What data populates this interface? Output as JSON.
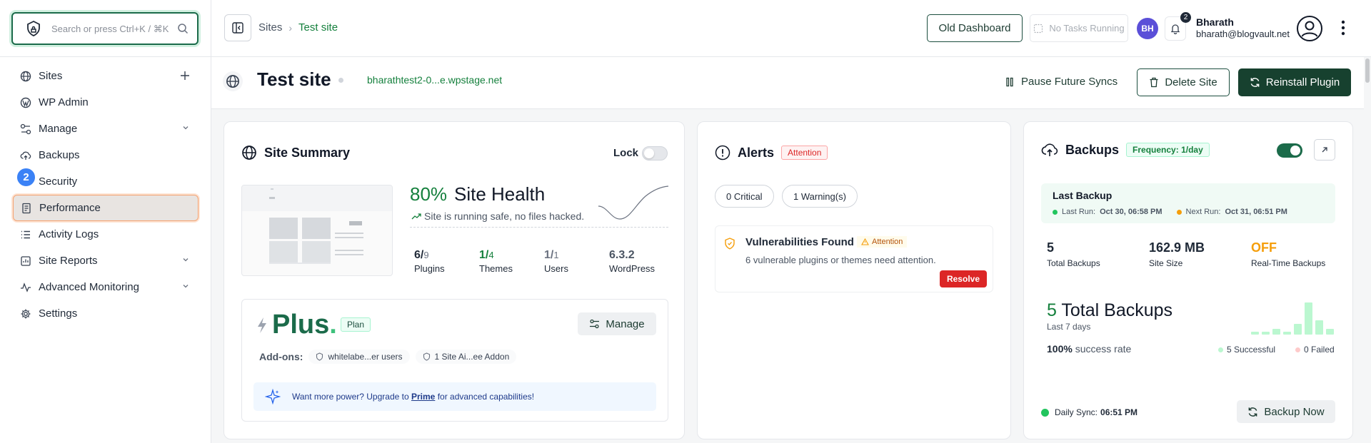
{
  "search": {
    "placeholder": "Search or press Ctrl+K / ⌘K"
  },
  "sidebar": {
    "step_badge": "2",
    "items": [
      {
        "label": "Sites",
        "icon": "globe-icon"
      },
      {
        "label": "WP Admin",
        "icon": "wordpress-icon"
      },
      {
        "label": "Manage",
        "icon": "manage-icon"
      },
      {
        "label": "Backups",
        "icon": "cloud-backup-icon"
      },
      {
        "label": "Security",
        "icon": "shield-icon"
      },
      {
        "label": "Performance",
        "icon": "performance-icon"
      },
      {
        "label": "Activity Logs",
        "icon": "list-icon"
      },
      {
        "label": "Site Reports",
        "icon": "report-icon"
      },
      {
        "label": "Advanced Monitoring",
        "icon": "activity-icon"
      },
      {
        "label": "Settings",
        "icon": "gear-icon"
      }
    ]
  },
  "topbar": {
    "breadcrumb": [
      "Sites",
      "Test site"
    ],
    "old_dashboard": "Old Dashboard",
    "tasks": "No Tasks Running",
    "avatar_initials": "BH",
    "notification_count": "2",
    "user_name": "Bharath",
    "user_email": "bharath@blogvault.net"
  },
  "site": {
    "title": "Test site",
    "url": "bharathtest2-0...e.wpstage.net",
    "pause_label": "Pause Future Syncs",
    "delete_label": "Delete Site",
    "reinstall_label": "Reinstall Plugin"
  },
  "summary": {
    "title": "Site Summary",
    "lock_label": "Lock",
    "health_pct": "80%",
    "health_label": "Site Health",
    "health_sub": "Site is running safe, no files hacked.",
    "stats": [
      {
        "value": "6/",
        "total": "9",
        "label": "Plugins"
      },
      {
        "value": "1/",
        "total": "4",
        "label": "Themes"
      },
      {
        "value": "1/",
        "total": "1",
        "label": "Users"
      },
      {
        "value": "6.3.2",
        "total": "",
        "label": "WordPress"
      }
    ],
    "plan": {
      "name": "Plus",
      "dot": ".",
      "badge": "Plan",
      "manage_label": "Manage",
      "addons_label": "Add-ons:",
      "addons": [
        "whitelabe...er users",
        "1 Site Ai...ee Addon"
      ],
      "upgrade_pre": "Want more power? Upgrade to",
      "upgrade_link": "Prime",
      "upgrade_post": "for advanced capabilities!"
    }
  },
  "alerts": {
    "title": "Alerts",
    "badge": "Attention",
    "critical": "0 Critical",
    "warnings": "1 Warning(s)",
    "vuln_title": "Vulnerabilities Found",
    "vuln_badge": "Attention",
    "vuln_desc": "6 vulnerable plugins or themes need attention.",
    "resolve": "Resolve"
  },
  "backups": {
    "title": "Backups",
    "frequency": "Frequency: 1/day",
    "last_title": "Last Backup",
    "last_run_label": "Last Run:",
    "last_run": "Oct 30, 06:58 PM",
    "next_run_label": "Next Run:",
    "next_run": "Oct 31, 06:51 PM",
    "stats": [
      {
        "value": "5",
        "label": "Total Backups"
      },
      {
        "value": "162.9 MB",
        "label": "Site Size"
      },
      {
        "value": "OFF",
        "label": "Real-Time Backups"
      }
    ],
    "big_count": "5",
    "big_label": "Total Backups",
    "period": "Last 7 days",
    "success_pct": "100%",
    "success_label": "success rate",
    "successful_legend": "5 Successful",
    "failed_legend": "0 Failed",
    "bar_levels": [
      0.08,
      0.08,
      0.15,
      0.08,
      0.3,
      0.9,
      0.4,
      0.15
    ],
    "sync_label": "Daily Sync:",
    "sync_time": "06:51 PM",
    "backup_now": "Backup Now"
  },
  "colors": {
    "brand": "#17412f",
    "accent_green": "#15803d",
    "danger": "#dc2626",
    "warning": "#f59e0b"
  }
}
